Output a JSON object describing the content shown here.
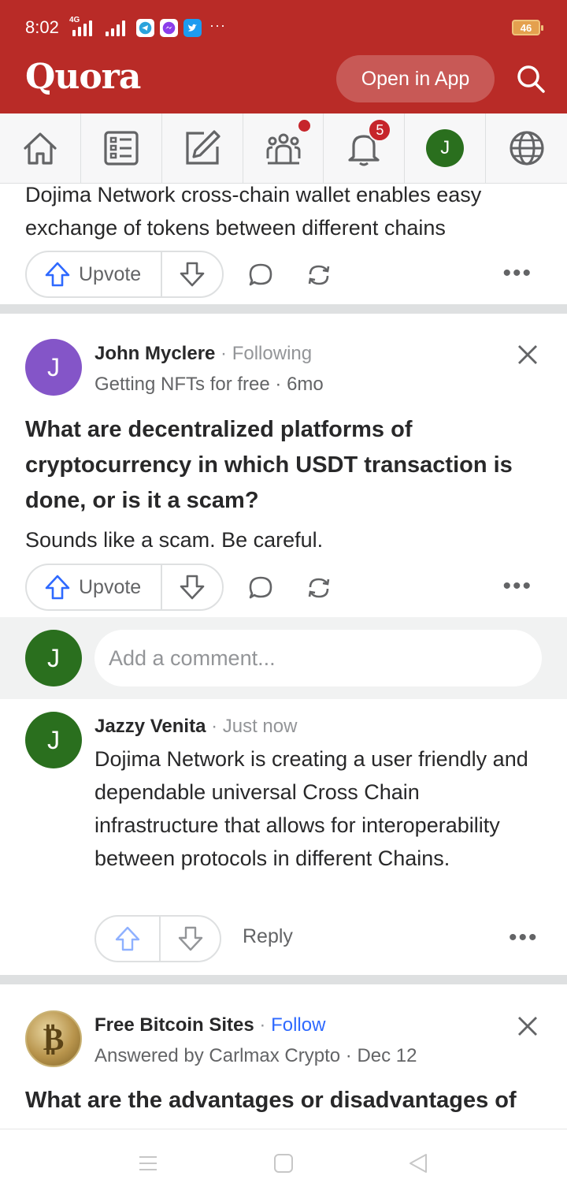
{
  "status_bar": {
    "time": "8:02",
    "network": "4G",
    "battery": "46",
    "more": "···",
    "notification_icons": [
      "telegram-icon",
      "messenger-icon",
      "twitter-icon"
    ]
  },
  "header": {
    "logo": "Quora",
    "open_app_label": "Open in App",
    "brand_color": "#b92b27"
  },
  "nav": {
    "items": [
      "home-icon",
      "following-icon",
      "answer-icon",
      "spaces-icon",
      "notifications-icon",
      "profile-avatar",
      "languages-icon"
    ],
    "notification_count": "5",
    "avatar_initial": "J"
  },
  "post1": {
    "text": "Dojima Network cross-chain wallet enables easy exchange of tokens between different chains",
    "upvote_label": "Upvote"
  },
  "post2": {
    "author_initial": "J",
    "author": "John Myclere",
    "separator": " · ",
    "follow_status": "Following",
    "space": "Getting NFTs for free",
    "time": "6mo",
    "question": "What are decentralized platforms of cryptocurrency in which USDT transaction is done, or is it a scam?",
    "answer": "Sounds like a scam. Be careful.",
    "upvote_label": "Upvote"
  },
  "comment_box": {
    "avatar_initial": "J",
    "placeholder": "Add a comment..."
  },
  "comment": {
    "avatar_initial": "J",
    "author": "Jazzy Venita",
    "time": "Just now",
    "text": "Dojima Network is creating a user friendly and dependable universal Cross Chain infrastructure that allows for interoperability between protocols in different Chains.",
    "reply_label": "Reply"
  },
  "post3": {
    "space": "Free Bitcoin Sites",
    "follow_label": "Follow",
    "answered_by": "Answered by Carlmax Crypto",
    "time": "Dec 12",
    "question": "What are the advantages or disadvantages of"
  }
}
